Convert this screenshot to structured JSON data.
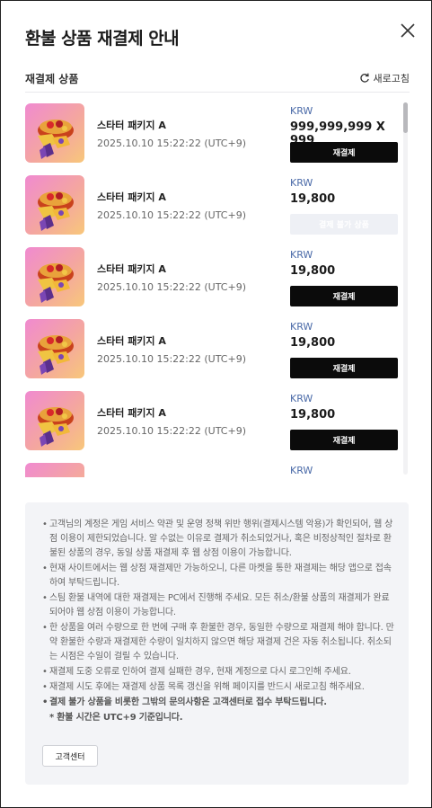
{
  "dialog": {
    "title": "환불 상품 재결제 안내",
    "close_icon": "close-icon"
  },
  "section": {
    "label": "재결제 상품",
    "refresh_label": "새로고침",
    "refresh_icon": "refresh-icon"
  },
  "items": [
    {
      "name": "스타터 패키지 A",
      "date": "2025.10.10 15:22:22 (UTC+9)",
      "currency": "KRW",
      "price": "999,999,999 X 999",
      "button": "재결제",
      "disabled": false
    },
    {
      "name": "스타터 패키지 A",
      "date": "2025.10.10 15:22:22 (UTC+9)",
      "currency": "KRW",
      "price": "19,800",
      "button": "결제 불가 상품",
      "disabled": true
    },
    {
      "name": "스타터 패키지 A",
      "date": "2025.10.10 15:22:22 (UTC+9)",
      "currency": "KRW",
      "price": "19,800",
      "button": "재결제",
      "disabled": false
    },
    {
      "name": "스타터 패키지 A",
      "date": "2025.10.10 15:22:22 (UTC+9)",
      "currency": "KRW",
      "price": "19,800",
      "button": "재결제",
      "disabled": false
    },
    {
      "name": "스타터 패키지 A",
      "date": "2025.10.10 15:22:22 (UTC+9)",
      "currency": "KRW",
      "price": "19,800",
      "button": "재결제",
      "disabled": false
    },
    {
      "name": "",
      "date": "",
      "currency": "KRW",
      "price": "",
      "button": "",
      "disabled": false
    }
  ],
  "notice": {
    "items": [
      {
        "text": "고객님의 계정은 게임 서비스 약관 및 운영 정책 위반 행위(결제시스템 악용)가 확인되어, 웹 상점 이용이 제한되었습니다. 알 수없는 이유로 결제가 취소되었거나, 혹은 비정상적인 절차로 환불된 상품의 경우, 동일 상품 재결제 후 웹 상점 이용이 가능합니다.",
        "bold": false
      },
      {
        "text": "현재 사이트에서는 웹 상점 재결제만 가능하오니, 다른 마켓을 통한 재결제는 해당 앱으로 접속하여 부탁드립니다.",
        "bold": false
      },
      {
        "text": "스팀 환불 내역에 대한 재결제는 PC에서 진행해 주세요. 모든 취소/환불 상품의 재결제가 완료되어야 웹 상점 이용이 가능합니다.",
        "bold": false
      },
      {
        "text": "한 상품을 여러 수량으로 한 번에 구매 후 환불한 경우, 동일한 수량으로 재결제 해야 합니다. 만약 환불한 수량과 재결제한 수량이 일치하지 않으면 해당 재결제 건은 자동 취소됩니다. 취소되는 시점은 수일이 걸릴 수 있습니다.",
        "bold": false
      },
      {
        "text": "재결제 도중 오류로 인하여 결제 실패한 경우, 현재 계정으로 다시 로그인해 주세요.",
        "bold": false
      },
      {
        "text": "재결제 시도 후에는 재결제 상품 목록 갱신을 위해 페이지를 반드시 새로고침 해주세요.",
        "bold": false
      },
      {
        "text": "결제 불가 상품을 비롯한 그밖의 문의사항은 고객센터로 접수 부탁드립니다.",
        "bold": true
      }
    ],
    "timezone_note": "* 환불 시간은 UTC+9 기준입니다.",
    "cs_button": "고객센터"
  },
  "colors": {
    "accent": "#0b0b0b",
    "currency": "#4a6aa8",
    "notice_bg": "#f3f4f7",
    "disabled_btn": "#eef0f5"
  }
}
